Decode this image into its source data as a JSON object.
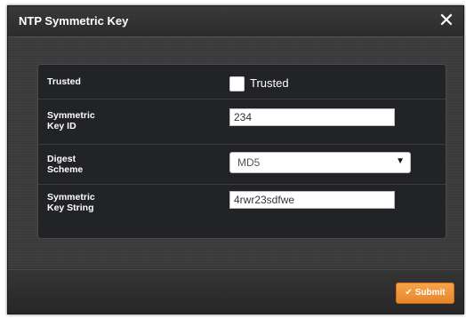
{
  "dialog": {
    "title": "NTP Symmetric Key",
    "close_icon": "✕"
  },
  "form": {
    "trusted": {
      "label": "Trusted",
      "checkbox_label": "Trusted",
      "checked": false
    },
    "key_id": {
      "label": "Symmetric\nKey ID",
      "value": "234"
    },
    "digest_scheme": {
      "label": "Digest\nScheme",
      "selected": "MD5",
      "arrow_icon": "▼"
    },
    "key_string": {
      "label": "Symmetric\nKey String",
      "value": "4rwr23sdfwe"
    }
  },
  "footer": {
    "submit_label": "Submit",
    "submit_icon": "✔"
  },
  "colors": {
    "accent": "#f0952f",
    "dialog_bg": "#2e2e2e",
    "panel_bg": "#222326"
  }
}
